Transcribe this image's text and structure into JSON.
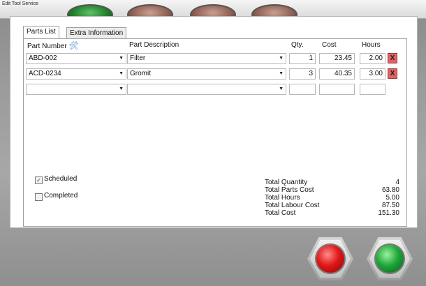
{
  "window": {
    "title": "Edit Tool Service"
  },
  "tabs": [
    {
      "label": "Parts List",
      "active": true
    },
    {
      "label": "Extra Information",
      "active": false
    }
  ],
  "columns": {
    "part_number": "Part Number",
    "part_description": "Part Description",
    "qty": "Qty.",
    "cost": "Cost",
    "hours": "Hours"
  },
  "rows": [
    {
      "part_number": "ABD-002",
      "description": "Filter",
      "qty": "1",
      "cost": "23.45",
      "hours": "2.00",
      "delete": "X"
    },
    {
      "part_number": "ACD-0234",
      "description": "Gromit",
      "qty": "3",
      "cost": "40.35",
      "hours": "3.00",
      "delete": "X"
    },
    {
      "part_number": "",
      "description": "",
      "qty": "",
      "cost": "",
      "hours": ""
    }
  ],
  "checkboxes": {
    "scheduled": {
      "label": "Scheduled",
      "checked": true,
      "mark": "✓"
    },
    "completed": {
      "label": "Completed",
      "checked": false
    }
  },
  "totals": {
    "quantity": {
      "label": "Total Quantity",
      "value": "4"
    },
    "parts_cost": {
      "label": "Total Parts Cost",
      "value": "63.80"
    },
    "hours": {
      "label": "Total Hours",
      "value": "5.00"
    },
    "labour_cost": {
      "label": "Total Labour Cost",
      "value": "87.50"
    },
    "cost": {
      "label": "Total Cost",
      "value": "151.30"
    }
  },
  "icons": {
    "part_number_header": "wrench-icon",
    "cancel_button": "red-button-icon",
    "confirm_button": "green-button-icon"
  },
  "colors": {
    "delete_button": "#e06262",
    "cancel_button": "#e01818",
    "confirm_button": "#1fa83a"
  }
}
